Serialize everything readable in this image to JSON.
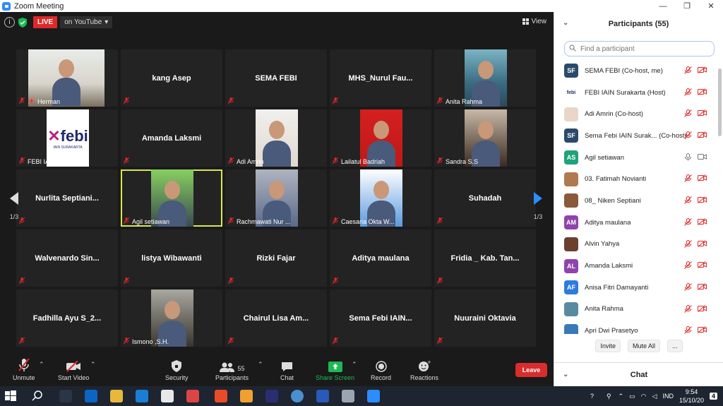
{
  "window": {
    "title": "Zoom Meeting",
    "minimize": "—",
    "maximize": "❐",
    "close": "✕"
  },
  "meeting": {
    "live_label": "LIVE",
    "stream_label": "on YouTube",
    "view_label": "View",
    "page_indicator": "1/3"
  },
  "tiles": [
    {
      "name": "Herman",
      "kind": "video"
    },
    {
      "name": "kang Asep",
      "kind": "name"
    },
    {
      "name": "SEMA FEBI",
      "kind": "name"
    },
    {
      "name": "MHS_Nurul  Fau...",
      "kind": "name"
    },
    {
      "name": "Anita Rahma",
      "kind": "photo"
    },
    {
      "name": "FEBI IAIN Surakar...",
      "kind": "logo",
      "logo_text": "febi",
      "logo_sub": "IAIN SURAKARTA"
    },
    {
      "name": "Amanda Laksmi",
      "kind": "name"
    },
    {
      "name": "Adi Amrin",
      "kind": "photo"
    },
    {
      "name": "Lailatul Badriah",
      "kind": "photo"
    },
    {
      "name": "Sandra S.S",
      "kind": "photo"
    },
    {
      "name": "Nurlita  Septiani...",
      "kind": "name"
    },
    {
      "name": "Agil setiawan",
      "kind": "video"
    },
    {
      "name": "Rachmawati Nur ...",
      "kind": "photo"
    },
    {
      "name": "Caesaria Okta W...",
      "kind": "photo"
    },
    {
      "name": "Suhadah",
      "kind": "name"
    },
    {
      "name": "Walvenardo  Sin...",
      "kind": "name"
    },
    {
      "name": "listya Wibawanti",
      "kind": "name"
    },
    {
      "name": "Rizki Fajar",
      "kind": "name"
    },
    {
      "name": "Aditya maulana",
      "kind": "name"
    },
    {
      "name": "Fridia _ Kab. Tan...",
      "kind": "name"
    },
    {
      "name": "Fadhilla Ayu S_2...",
      "kind": "name"
    },
    {
      "name": "Ismono ,S.H.",
      "kind": "photo"
    },
    {
      "name": "Chairul Lisa Am...",
      "kind": "name"
    },
    {
      "name": "Sema Febi IAIN...",
      "kind": "name"
    },
    {
      "name": "Nuuraini Oktavia",
      "kind": "name"
    }
  ],
  "toolbar": {
    "unmute": "Unmute",
    "start_video": "Start Video",
    "security": "Security",
    "participants": "Participants",
    "participants_count": "55",
    "chat": "Chat",
    "share_screen": "Share Screen",
    "record": "Record",
    "reactions": "Reactions",
    "leave": "Leave"
  },
  "panel": {
    "title": "Participants (55)",
    "search_placeholder": "Find a participant",
    "invite": "Invite",
    "mute_all": "Mute All",
    "more": "...",
    "chat_title": "Chat",
    "participants": [
      {
        "initials": "SF",
        "color": "#2b4a6b",
        "name": "SEMA FEBI (Co-host, me)",
        "mic": "off"
      },
      {
        "initials": "febi",
        "color": "#ffffff",
        "name": "FEBI IAIN Surakarta (Host)",
        "mic": "off"
      },
      {
        "initials": "",
        "color": "#e9d6c9",
        "name": "Adi Amrin (Co-host)",
        "mic": "off"
      },
      {
        "initials": "SF",
        "color": "#2b4a6b",
        "name": "Sema Febi IAIN Surak...  (Co-host)",
        "mic": "off"
      },
      {
        "initials": "AS",
        "color": "#1fa37c",
        "name": "Agil setiawan",
        "mic": "on"
      },
      {
        "initials": "",
        "color": "#b07a50",
        "name": "03. Fatimah Novianti",
        "mic": "off"
      },
      {
        "initials": "",
        "color": "#8a5a3a",
        "name": "08_ Niken Septiani",
        "mic": "off"
      },
      {
        "initials": "AM",
        "color": "#8e44ad",
        "name": "Aditya maulana",
        "mic": "off"
      },
      {
        "initials": "",
        "color": "#6b4030",
        "name": "Alvin Yahya",
        "mic": "off"
      },
      {
        "initials": "AL",
        "color": "#8e44ad",
        "name": "Amanda Laksmi",
        "mic": "off"
      },
      {
        "initials": "AF",
        "color": "#2d7be0",
        "name": "Anisa Fitri Damayanti",
        "mic": "off"
      },
      {
        "initials": "",
        "color": "#5a8aa0",
        "name": "Anita Rahma",
        "mic": "off"
      },
      {
        "initials": "",
        "color": "#3a78b8",
        "name": "Apri Dwi Prasetyo",
        "mic": "off"
      }
    ]
  },
  "taskbar": {
    "time": "9:54",
    "date": "15/10/20",
    "lang": "IND",
    "notifications": "4"
  }
}
